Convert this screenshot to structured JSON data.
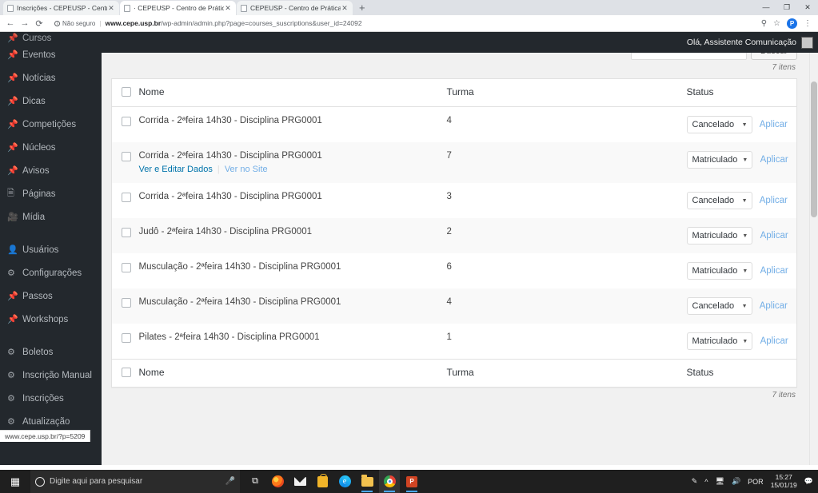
{
  "browser": {
    "tabs": [
      {
        "title": "Inscrições - CEPEUSP - Centro de",
        "active": false
      },
      {
        "title": "· CEPEUSP - Centro de Práticas E",
        "active": true
      },
      {
        "title": "CEPEUSP - Centro de Práticas Es",
        "active": false
      }
    ],
    "new_tab_label": "+",
    "close_label": "✕",
    "window_controls": {
      "minimize": "—",
      "maximize": "❐",
      "close": "✕"
    },
    "nav": {
      "back": "←",
      "forward": "→",
      "reload": "⟳"
    },
    "omnibox": {
      "security_label": "Não seguro",
      "security_icon": "info-icon",
      "url_host": "www.cepe.usp.br",
      "url_path": "/wp-admin/admin.php?page=courses_suscriptions&user_id=24092"
    },
    "toolbar_icons": {
      "search": "search-icon",
      "bookmark": "star-icon",
      "profile_letter": "P",
      "menu": "⋮"
    },
    "status_bar_url": "www.cepe.usp.br/?p=5209"
  },
  "admin_bar": {
    "greeting": "Olá, Assistente Comunicação"
  },
  "sidebar": {
    "items": [
      {
        "label": "Cursos",
        "icon": "pin-icon",
        "clipped": true
      },
      {
        "label": "Eventos",
        "icon": "pin-icon"
      },
      {
        "label": "Notícias",
        "icon": "pin-icon"
      },
      {
        "label": "Dicas",
        "icon": "pin-icon"
      },
      {
        "label": "Competições",
        "icon": "pin-icon"
      },
      {
        "label": "Núcleos",
        "icon": "pin-icon"
      },
      {
        "label": "Avisos",
        "icon": "pin-icon"
      },
      {
        "label": "Páginas",
        "icon": "pages-icon"
      },
      {
        "label": "Mídia",
        "icon": "media-icon"
      },
      {
        "label": "Usuários",
        "icon": "user-icon",
        "gap_before": true
      },
      {
        "label": "Configurações",
        "icon": "settings-icon"
      },
      {
        "label": "Passos",
        "icon": "pin-icon"
      },
      {
        "label": "Workshops",
        "icon": "pin-icon"
      },
      {
        "label": "Boletos",
        "icon": "gear-icon",
        "gap_before": true
      },
      {
        "label": "Inscrição Manual",
        "icon": "gear-icon"
      },
      {
        "label": "Inscrições",
        "icon": "gear-icon"
      },
      {
        "label": "Atualização",
        "icon": "gear-icon"
      }
    ]
  },
  "main": {
    "search": {
      "value": "",
      "placeholder": "",
      "button_label": "Buscar"
    },
    "count_top": "7 itens",
    "count_bottom": "7 itens",
    "columns": {
      "nome": "Nome",
      "turma": "Turma",
      "status": "Status"
    },
    "status_options": [
      "Matriculado",
      "Cancelado"
    ],
    "apply_label": "Aplicar",
    "row_actions": {
      "edit": "Ver e Editar Dados",
      "view": "Ver no Site",
      "separator": "|"
    },
    "rows": [
      {
        "nome": "Corrida - 2ªfeira 14h30 - Disciplina PRG0001",
        "turma": "4",
        "status": "Cancelado",
        "show_actions": false
      },
      {
        "nome": "Corrida - 2ªfeira 14h30 - Disciplina PRG0001",
        "turma": "7",
        "status": "Matriculado",
        "show_actions": true
      },
      {
        "nome": "Corrida - 2ªfeira 14h30 - Disciplina PRG0001",
        "turma": "3",
        "status": "Cancelado",
        "show_actions": false
      },
      {
        "nome": "Judô - 2ªfeira 14h30 - Disciplina PRG0001",
        "turma": "2",
        "status": "Matriculado",
        "show_actions": false
      },
      {
        "nome": "Musculação - 2ªfeira 14h30 - Disciplina PRG0001",
        "turma": "6",
        "status": "Matriculado",
        "show_actions": false
      },
      {
        "nome": "Musculação - 2ªfeira 14h30 - Disciplina PRG0001",
        "turma": "4",
        "status": "Cancelado",
        "show_actions": false
      },
      {
        "nome": "Pilates - 2ªfeira 14h30 - Disciplina PRG0001",
        "turma": "1",
        "status": "Matriculado",
        "show_actions": false
      }
    ]
  },
  "taskbar": {
    "start_icon": "windows-start-icon",
    "search_placeholder": "Digite aqui para pesquisar",
    "mic_icon": "microphone-icon",
    "taskview_icon": "task-view-icon",
    "apps": [
      {
        "name": "firefox-icon"
      },
      {
        "name": "mail-icon"
      },
      {
        "name": "store-icon"
      },
      {
        "name": "edge-icon"
      },
      {
        "name": "file-explorer-icon"
      },
      {
        "name": "chrome-icon"
      },
      {
        "name": "powerpoint-icon"
      }
    ],
    "tray": {
      "pen_icon": "pen-icon",
      "chevron_icon": "show-hidden-icons-icon",
      "network_icon": "network-icon",
      "volume_icon": "volume-icon",
      "language": "POR",
      "time": "15:27",
      "date": "15/01/19",
      "notifications_icon": "action-center-icon"
    }
  }
}
